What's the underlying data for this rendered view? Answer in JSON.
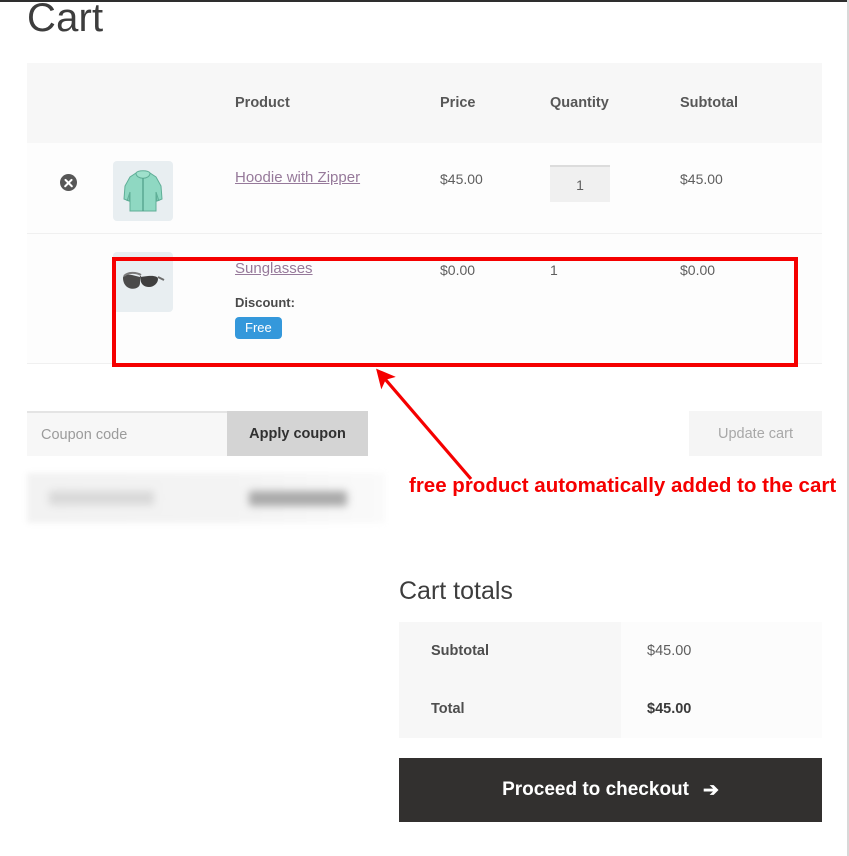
{
  "page": {
    "title": "Cart"
  },
  "cart_table": {
    "headers": {
      "remove": "",
      "thumbnail": "",
      "product": "Product",
      "price": "Price",
      "quantity": "Quantity",
      "subtotal": "Subtotal"
    },
    "rows": [
      {
        "remove_icon": "remove-circle-x-icon",
        "thumbnail_icon": "hoodie-with-zipper-thumbnail",
        "name": "Hoodie with Zipper",
        "price": "$45.00",
        "quantity": "1",
        "subtotal": "$45.00",
        "has_remove": true,
        "discount_label": null,
        "discount_badge": null
      },
      {
        "remove_icon": null,
        "thumbnail_icon": "sunglasses-thumbnail",
        "name": "Sunglasses",
        "price": "$0.00",
        "quantity": "1",
        "subtotal": "$0.00",
        "has_remove": false,
        "discount_label": "Discount:",
        "discount_badge": "Free"
      }
    ]
  },
  "coupon": {
    "placeholder": "Coupon code",
    "value": "",
    "apply_label": "Apply coupon",
    "update_label": "Update cart"
  },
  "totals": {
    "title": "Cart totals",
    "rows": [
      {
        "label": "Subtotal",
        "value": "$45.00"
      },
      {
        "label": "Total",
        "value": "$45.00"
      }
    ],
    "checkout_label": "Proceed to checkout",
    "checkout_arrow": "➔"
  },
  "annotation": {
    "text": "free product automatically added to the cart",
    "color": "#f50000"
  },
  "colors": {
    "badge_free": "#3498db",
    "product_link": "#96799a",
    "checkout_button": "#32302f",
    "apply_coupon_button": "#d4d4d4",
    "header_row": "#f7f7f7"
  }
}
